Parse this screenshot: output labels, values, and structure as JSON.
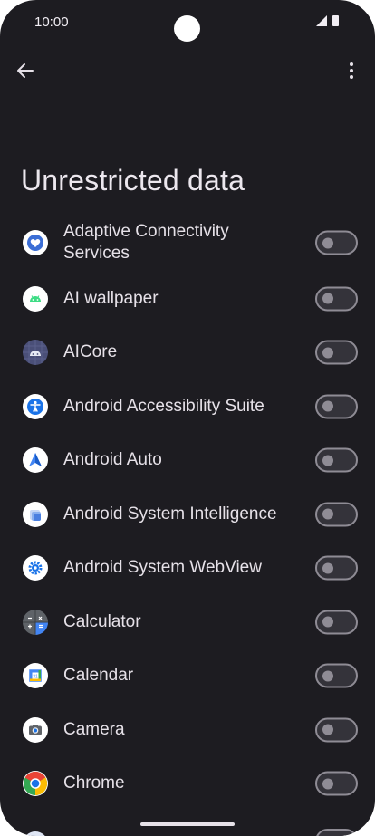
{
  "status_bar": {
    "time": "10:00"
  },
  "page": {
    "title": "Unrestricted data"
  },
  "apps": [
    {
      "label": "Adaptive Connectivity Services",
      "icon": "adaptive-connectivity-icon",
      "enabled": false
    },
    {
      "label": "AI wallpaper",
      "icon": "android-robot-icon",
      "enabled": false
    },
    {
      "label": "AICore",
      "icon": "aicore-icon",
      "enabled": false
    },
    {
      "label": "Android Accessibility Suite",
      "icon": "accessibility-icon",
      "enabled": false
    },
    {
      "label": "Android Auto",
      "icon": "android-auto-icon",
      "enabled": false
    },
    {
      "label": "Android System Intelligence",
      "icon": "system-intelligence-icon",
      "enabled": false
    },
    {
      "label": "Android System WebView",
      "icon": "webview-gear-icon",
      "enabled": false
    },
    {
      "label": "Calculator",
      "icon": "calculator-icon",
      "enabled": false
    },
    {
      "label": "Calendar",
      "icon": "calendar-icon",
      "enabled": false
    },
    {
      "label": "Camera",
      "icon": "camera-icon",
      "enabled": false
    },
    {
      "label": "Chrome",
      "icon": "chrome-icon",
      "enabled": false
    }
  ]
}
